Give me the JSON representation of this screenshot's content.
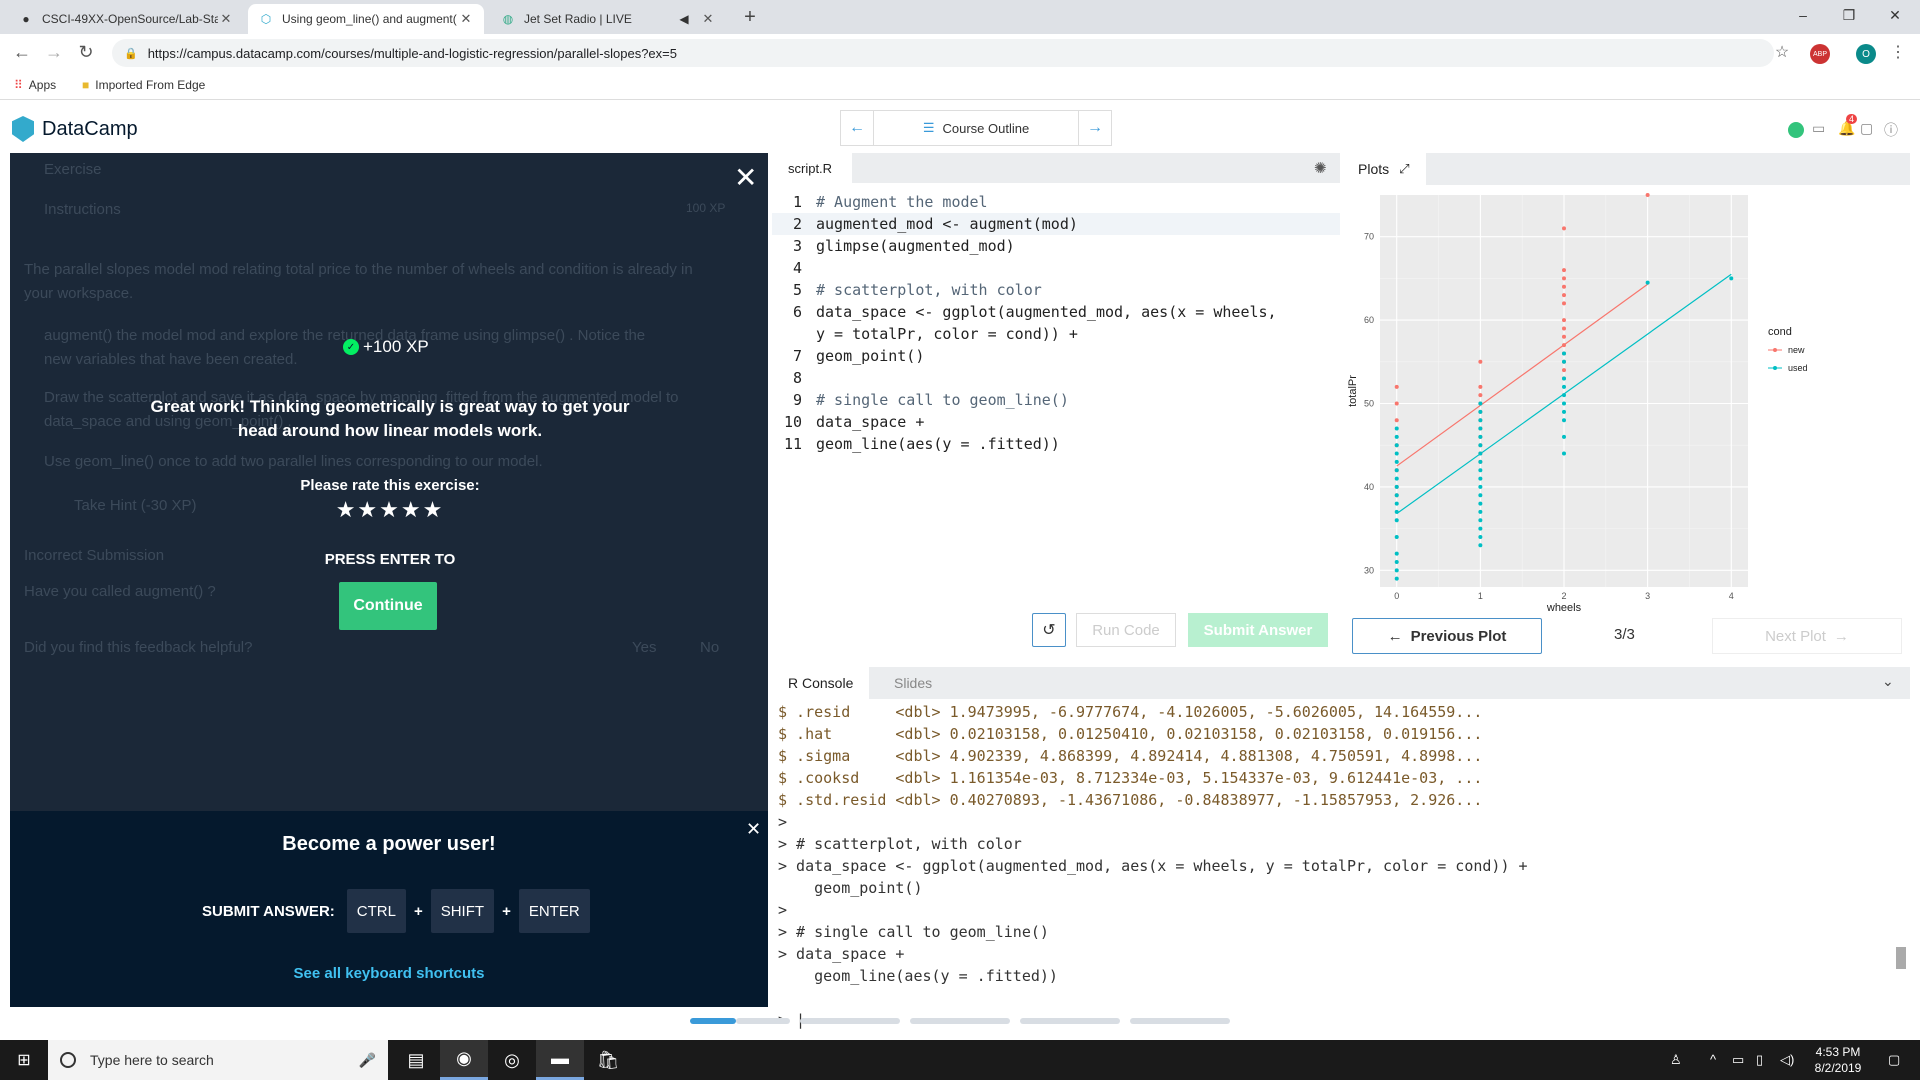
{
  "browser": {
    "tabs": [
      {
        "label": "CSCI-49XX-OpenSource/Lab-Stat",
        "icon": "github-icon"
      },
      {
        "label": "Using geom_line() and augment(",
        "icon": "datacamp-icon"
      },
      {
        "label": "Jet Set Radio | LIVE",
        "icon": "globe-icon"
      }
    ],
    "url": "https://campus.datacamp.com/courses/multiple-and-logistic-regression/parallel-slopes?ex=5",
    "profile_initial": "O",
    "abp": "ABP",
    "bookmarks": [
      {
        "label": "Apps",
        "icon": "apps-grid-icon"
      },
      {
        "label": "Imported From Edge",
        "icon": "folder-icon"
      }
    ]
  },
  "header": {
    "logo": "DataCamp",
    "course_outline": "Course Outline",
    "notification_count": "4"
  },
  "background_text": [
    "Exercise",
    "Instructions",
    "100 XP",
    "The parallel slopes model  mod  relating total price to the number of wheels and condition is already in",
    "your workspace.",
    "augment()  the model  mod  and explore the returned data frame using  glimpse() . Notice the",
    "new variables that have been created.",
    "Draw the scatterplot and save it as  data_space  by mapping  .fitted  from the augmented model to",
    "data_space  and using  geom_point() .",
    "Use  geom_line()  once to add two parallel lines corresponding to our model.",
    "Take Hint (-30 XP)",
    "Incorrect Submission",
    "Have you called  augment() ?",
    "Did you find this feedback helpful?",
    "Yes",
    "No"
  ],
  "modal": {
    "xp": "+100 XP",
    "message": "Great work! Thinking geometrically is great way to get your head around how linear models work.",
    "rate_prompt": "Please rate this exercise:",
    "stars": "★★★★★",
    "press_enter": "PRESS ENTER TO",
    "continue": "Continue"
  },
  "power_user": {
    "title": "Become a power user!",
    "submit_label": "SUBMIT ANSWER:",
    "keys": [
      "CTRL",
      "SHIFT",
      "ENTER"
    ],
    "plus": "+",
    "shortcuts_link": "See all keyboard shortcuts"
  },
  "editor": {
    "tab": "script.R",
    "lines": [
      {
        "n": "1",
        "code": "# Augment the model",
        "comment": true
      },
      {
        "n": "2",
        "code": "augmented_mod <- augment(mod)",
        "comment": false,
        "highlight": true
      },
      {
        "n": "3",
        "code": "glimpse(augmented_mod)",
        "comment": false
      },
      {
        "n": "4",
        "code": "",
        "comment": false
      },
      {
        "n": "5",
        "code": "# scatterplot, with color",
        "comment": true
      },
      {
        "n": "6",
        "code": "data_space <- ggplot(augmented_mod, aes(x = wheels,",
        "comment": false
      },
      {
        "n": "",
        "code": "y = totalPr, color = cond)) +",
        "comment": false
      },
      {
        "n": "7",
        "code": "  geom_point()",
        "comment": false
      },
      {
        "n": "8",
        "code": "",
        "comment": false
      },
      {
        "n": "9",
        "code": "# single call to geom_line()",
        "comment": true
      },
      {
        "n": "10",
        "code": "data_space +",
        "comment": false
      },
      {
        "n": "11",
        "code": "  geom_line(aes(y = .fitted))",
        "comment": false
      }
    ],
    "run_code": "Run Code",
    "submit_answer": "Submit Answer"
  },
  "plots": {
    "tab": "Plots",
    "previous": "Previous Plot",
    "count": "3/3",
    "next": "Next Plot"
  },
  "chart_data": {
    "type": "scatter",
    "xlabel": "wheels",
    "ylabel": "totalPr",
    "xlim": [
      -0.2,
      4.2
    ],
    "ylim": [
      28,
      75
    ],
    "xticks": [
      0,
      1,
      2,
      3,
      4
    ],
    "yticks": [
      30,
      40,
      50,
      60,
      70
    ],
    "legend_title": "cond",
    "legend_position": "right",
    "grid": true,
    "series": [
      {
        "name": "new",
        "color": "#f8766d",
        "points": [
          [
            0,
            40
          ],
          [
            0,
            42
          ],
          [
            0,
            45
          ],
          [
            0,
            48
          ],
          [
            0,
            50
          ],
          [
            0,
            52
          ],
          [
            0,
            39
          ],
          [
            1,
            43
          ],
          [
            1,
            44
          ],
          [
            1,
            45
          ],
          [
            1,
            46
          ],
          [
            1,
            47
          ],
          [
            1,
            48
          ],
          [
            1,
            49
          ],
          [
            1,
            50
          ],
          [
            1,
            51
          ],
          [
            1,
            52
          ],
          [
            1,
            55
          ],
          [
            2,
            53
          ],
          [
            2,
            54
          ],
          [
            2,
            55
          ],
          [
            2,
            56
          ],
          [
            2,
            57
          ],
          [
            2,
            58
          ],
          [
            2,
            59
          ],
          [
            2,
            60
          ],
          [
            2,
            62
          ],
          [
            2,
            63
          ],
          [
            2,
            64
          ],
          [
            2,
            65
          ],
          [
            2,
            66
          ],
          [
            2,
            71
          ],
          [
            3,
            75
          ]
        ],
        "line": [
          [
            0,
            42.5
          ],
          [
            3,
            64.3
          ]
        ]
      },
      {
        "name": "used",
        "color": "#00bfc4",
        "points": [
          [
            0,
            29
          ],
          [
            0,
            30
          ],
          [
            0,
            31
          ],
          [
            0,
            32
          ],
          [
            0,
            34
          ],
          [
            0,
            36
          ],
          [
            0,
            37
          ],
          [
            0,
            38
          ],
          [
            0,
            39
          ],
          [
            0,
            40
          ],
          [
            0,
            41
          ],
          [
            0,
            42
          ],
          [
            0,
            43
          ],
          [
            0,
            44
          ],
          [
            0,
            45
          ],
          [
            0,
            46
          ],
          [
            0,
            47
          ],
          [
            1,
            33
          ],
          [
            1,
            34
          ],
          [
            1,
            35
          ],
          [
            1,
            36
          ],
          [
            1,
            37
          ],
          [
            1,
            38
          ],
          [
            1,
            39
          ],
          [
            1,
            40
          ],
          [
            1,
            41
          ],
          [
            1,
            42
          ],
          [
            1,
            43
          ],
          [
            1,
            44
          ],
          [
            1,
            45
          ],
          [
            1,
            46
          ],
          [
            1,
            47
          ],
          [
            1,
            48
          ],
          [
            1,
            49
          ],
          [
            1,
            50
          ],
          [
            2,
            44
          ],
          [
            2,
            46
          ],
          [
            2,
            48
          ],
          [
            2,
            49
          ],
          [
            2,
            50
          ],
          [
            2,
            51
          ],
          [
            2,
            52
          ],
          [
            2,
            53
          ],
          [
            2,
            55
          ],
          [
            2,
            56
          ],
          [
            3,
            64.5
          ],
          [
            4,
            65
          ]
        ],
        "line": [
          [
            0,
            36.8
          ],
          [
            4,
            65.5
          ]
        ]
      }
    ]
  },
  "console": {
    "tabs": [
      "R Console",
      "Slides"
    ],
    "lines": [
      {
        "t": "$ .resid     <dbl> 1.9473995, -6.9777674, -4.1026005, -5.6026005, 14.164559...",
        "out": true
      },
      {
        "t": "$ .hat       <dbl> 0.02103158, 0.01250410, 0.02103158, 0.02103158, 0.019156...",
        "out": true
      },
      {
        "t": "$ .sigma     <dbl> 4.902339, 4.868399, 4.892414, 4.881308, 4.750591, 4.8998...",
        "out": true
      },
      {
        "t": "$ .cooksd    <dbl> 1.161354e-03, 8.712334e-03, 5.154337e-03, 9.612441e-03, ...",
        "out": true
      },
      {
        "t": "$ .std.resid <dbl> 0.40270893, -1.43671086, -0.84838977, -1.15857953, 2.926...",
        "out": true
      },
      {
        "t": ">",
        "out": false
      },
      {
        "t": "> # scatterplot, with color",
        "out": false
      },
      {
        "t": "> data_space <- ggplot(augmented_mod, aes(x = wheels, y = totalPr, color = cond)) +",
        "out": false
      },
      {
        "t": "    geom_point()",
        "out": false
      },
      {
        "t": ">",
        "out": false
      },
      {
        "t": "> # single call to geom_line()",
        "out": false
      },
      {
        "t": "> data_space +",
        "out": false
      },
      {
        "t": "    geom_line(aes(y = .fitted))",
        "out": false
      },
      {
        "t": "",
        "out": false
      },
      {
        "t": "> |",
        "out": false
      }
    ]
  },
  "taskbar": {
    "search_placeholder": "Type here to search",
    "time": "4:53 PM",
    "date": "8/2/2019"
  }
}
